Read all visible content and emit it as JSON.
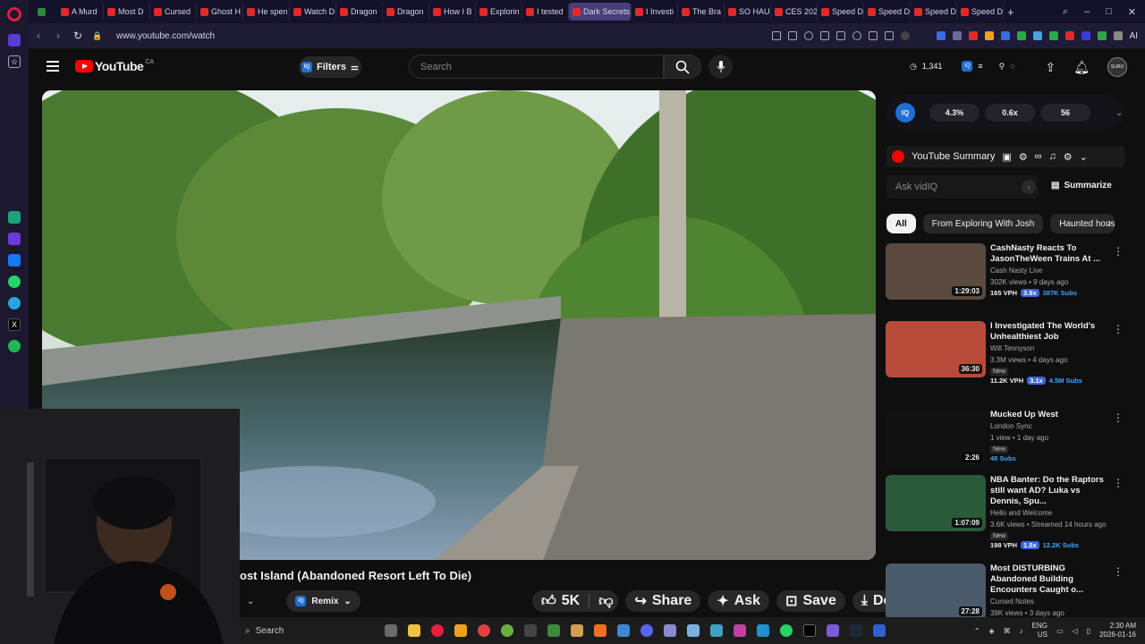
{
  "browser": {
    "tabs": [
      {
        "label": "A Murd"
      },
      {
        "label": "Most D"
      },
      {
        "label": "Cursed"
      },
      {
        "label": "Ghost H"
      },
      {
        "label": "He spen"
      },
      {
        "label": "Watch D"
      },
      {
        "label": "Dragon"
      },
      {
        "label": "Dragon"
      },
      {
        "label": "How I B"
      },
      {
        "label": "Explorin"
      },
      {
        "label": "I tested"
      },
      {
        "label": "Dark Secrets H"
      },
      {
        "label": "I Investi"
      },
      {
        "label": "The Bra"
      },
      {
        "label": "SO HAU"
      },
      {
        "label": "CES 202"
      },
      {
        "label": "Speed D"
      },
      {
        "label": "Speed D"
      },
      {
        "label": "Speed D"
      },
      {
        "label": "Speed D"
      }
    ],
    "active_tab_index": 11,
    "url": "www.youtube.com/watch",
    "ai_label": "AI"
  },
  "yt_header": {
    "logo_text": "YouTube",
    "country": "CA",
    "filters_label": "Filters",
    "search_placeholder": "Search",
    "views_count": "1,341",
    "avatar_text": "SURU"
  },
  "video": {
    "title": "ost Island (Abandoned Resort Left To Die)",
    "remix_label": "Remix",
    "like_count": "5K",
    "share_label": "Share",
    "ask_label": "Ask",
    "save_label": "Save",
    "download_label": "Download"
  },
  "vidiq": {
    "badge": "IQ",
    "stats": [
      "4.3%",
      "0.6x",
      "56"
    ]
  },
  "summary": {
    "label": "YouTube Summary",
    "ask_placeholder": "Ask vidIQ",
    "summarize_label": "Summarize"
  },
  "filter_chips": [
    "All",
    "From Exploring With Josh",
    "Haunted house"
  ],
  "recommendations": [
    {
      "title": "CashNasty Reacts To JasonTheWeen Trains At ...",
      "channel": "Cash Nasty Live",
      "meta": "302K views • 9 days ago",
      "duration": "1:29:03",
      "new": "",
      "vph": "165 VPH",
      "mult": "3.9x",
      "subs": "387K Subs"
    },
    {
      "title": "I Investigated The World's Unhealthiest Job",
      "channel": "Will Tennyson",
      "meta": "3.3M views • 4 days ago",
      "duration": "36:30",
      "new": "New",
      "vph": "11.2K VPH",
      "mult": "3.1x",
      "subs": "4.5M Subs"
    },
    {
      "title": "Mucked Up West",
      "channel": "London Sync",
      "meta": "1 view • 1 day ago",
      "duration": "2:26",
      "new": "New",
      "vph": "",
      "mult": "",
      "subs": "48 Subs"
    },
    {
      "title": "NBA Banter: Do the Raptors still want AD? Luka vs Dennis, Spu...",
      "channel": "Hello and Welcome",
      "meta": "3.6K views • Streamed 14 hours ago",
      "duration": "1:07:09",
      "new": "New",
      "vph": "198 VPH",
      "mult": "1.5x",
      "subs": "12.2K Subs"
    },
    {
      "title": "Most DISTURBING Abandoned Building Encounters Caught o...",
      "channel": "Cursed Notes",
      "meta": "39K views • 3 days ago",
      "duration": "27:28",
      "new": "",
      "vph": "",
      "mult": "",
      "subs": ""
    }
  ],
  "taskbar": {
    "search_label": "Search",
    "lang_top": "ENG",
    "lang_bottom": "US",
    "time": "2:30 AM",
    "date": "2026-01-16"
  },
  "colors": {
    "yt_red": "#ff0000",
    "vidiq_blue": "#1f6fd6",
    "subs_blue": "#3ea6ff",
    "opera_sidebar": "#1b1830"
  }
}
